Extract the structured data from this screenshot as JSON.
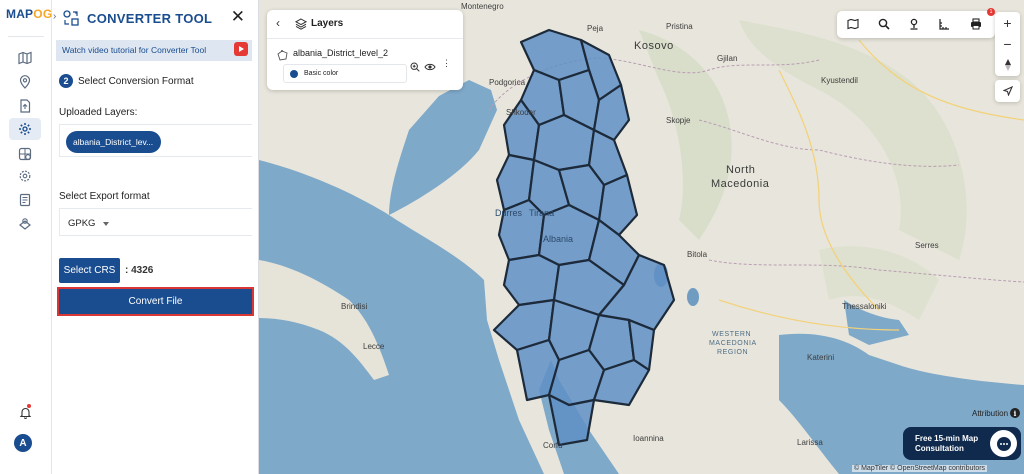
{
  "brand": {
    "logo_prefix": "MAP",
    "logo_suffix": "OG"
  },
  "rail": {
    "icons": [
      "map-icon",
      "location-pin-icon",
      "upload-file-icon",
      "settings-gear-icon",
      "layers-grid-icon",
      "cog-icon",
      "report-icon",
      "support-icon"
    ],
    "active_index": 3,
    "avatar_letter": "A"
  },
  "panel": {
    "title": "CONVERTER TOOL",
    "tutorial_text": "Watch video tutorial for Converter Tool",
    "step_number": "2",
    "step_title": "Select Conversion Format",
    "uploaded_label": "Uploaded Layers:",
    "uploaded_chip": "albania_District_lev...",
    "export_label": "Select Export format",
    "export_value": "GPKG",
    "crs_button": "Select CRS",
    "crs_value": ": 4326",
    "convert_button": "Convert File"
  },
  "layers_card": {
    "title": "Layers",
    "layer_name": "albania_District_level_2",
    "legend_label": "Basic color",
    "layer_color": "#1a4d8f"
  },
  "map": {
    "places": [
      "Montenegro",
      "Podgorica",
      "Shkoder",
      "Peja",
      "Pristina",
      "Kosovo",
      "Gjilan",
      "Kyustendil",
      "Skopje",
      "North",
      "Macedonia",
      "Durres",
      "Tirana",
      "Albania",
      "Bitola",
      "Serres",
      "Brindisi",
      "Lecce",
      "Thessaloniki",
      "WESTERN",
      "MACEDONIA",
      "REGION",
      "Katerini",
      "Ioannina",
      "Larissa",
      "Corfu"
    ],
    "attribution_label": "Attribution",
    "copyright": "© MapTiler © OpenStreetMap contributors",
    "consult_text": "Free 15-min Map Consultation",
    "notification_badge": "1",
    "colors": {
      "sea": "#7fa9c9",
      "land": "#e8e6dc",
      "district_fill": "#5f8fc6",
      "district_border": "#1d2a3a"
    }
  }
}
